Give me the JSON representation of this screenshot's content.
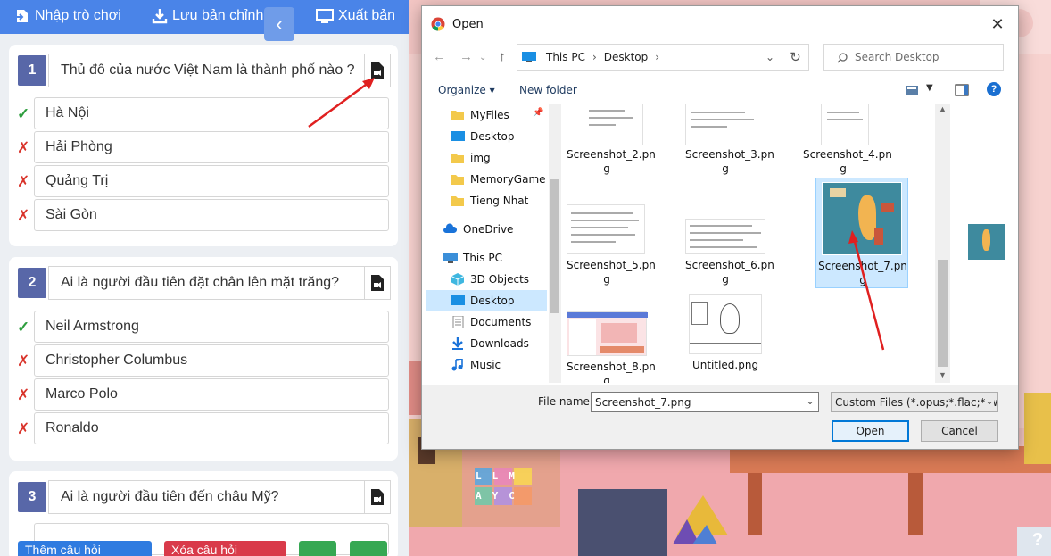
{
  "toolbar": {
    "import_label": "Nhập trò chơi",
    "save_label": "Lưu bản chỉnh sửa",
    "export_label": "Xuất bản"
  },
  "questions": [
    {
      "number": "1",
      "text": "Thủ đô của nước Việt Nam là thành phố nào ?",
      "answers": [
        {
          "text": "Hà Nội",
          "mark": "✓",
          "correct": true
        },
        {
          "text": "Hải Phòng",
          "mark": "✗",
          "correct": false
        },
        {
          "text": "Quảng Trị",
          "mark": "✗",
          "correct": false
        },
        {
          "text": "Sài Gòn",
          "mark": "✗",
          "correct": false
        }
      ]
    },
    {
      "number": "2",
      "text": "Ai là người đầu tiên đặt chân lên mặt trăng?",
      "answers": [
        {
          "text": "Neil Armstrong",
          "mark": "✓",
          "correct": true
        },
        {
          "text": "Christopher Columbus",
          "mark": "✗",
          "correct": false
        },
        {
          "text": "Marco Polo",
          "mark": "✗",
          "correct": false
        },
        {
          "text": "Ronaldo",
          "mark": "✗",
          "correct": false
        }
      ]
    },
    {
      "number": "3",
      "text": "Ai là người đầu tiên đến châu Mỹ?"
    }
  ],
  "bottom_buttons": {
    "add_label": "Thêm câu hỏi",
    "delete_label": "Xóa câu hỏi"
  },
  "scene": {
    "help_icon": "?",
    "blocks": [
      "L",
      "L",
      "M",
      "A",
      "Y",
      "C"
    ]
  },
  "dialog": {
    "title": "Open",
    "close_glyph": "✕",
    "breadcrumb": [
      "This PC",
      "Desktop"
    ],
    "search_placeholder": "Search Desktop",
    "organize_label": "Organize",
    "new_folder_label": "New folder",
    "nav_items": [
      {
        "label": "MyFiles",
        "icon": "folder-icon"
      },
      {
        "label": "Desktop",
        "icon": "desktop-icon"
      },
      {
        "label": "img",
        "icon": "folder-icon"
      },
      {
        "label": "MemoryGame",
        "icon": "folder-icon"
      },
      {
        "label": "Tieng Nhat",
        "icon": "folder-icon"
      },
      {
        "label": "OneDrive",
        "icon": "cloud-icon"
      },
      {
        "label": "This PC",
        "icon": "computer-icon"
      },
      {
        "label": "3D Objects",
        "icon": "cube-icon"
      },
      {
        "label": "Desktop",
        "icon": "desktop-icon",
        "selected": true
      },
      {
        "label": "Documents",
        "icon": "documents-icon"
      },
      {
        "label": "Downloads",
        "icon": "download-icon"
      },
      {
        "label": "Music",
        "icon": "music-icon"
      }
    ],
    "files": [
      {
        "line1": "Screenshot_2.pn",
        "line2": "g"
      },
      {
        "line1": "Screenshot_3.pn",
        "line2": "g"
      },
      {
        "line1": "Screenshot_4.pn",
        "line2": "g"
      },
      {
        "line1": "Screenshot_5.pn",
        "line2": "g"
      },
      {
        "line1": "Screenshot_6.pn",
        "line2": "g"
      },
      {
        "line1": "Screenshot_7.pn",
        "line2": "g",
        "selected": true
      },
      {
        "line1": "Screenshot_8.pn",
        "line2": "g"
      },
      {
        "line1": "Untitled.png",
        "line2": ""
      }
    ],
    "filename_label": "File name:",
    "filename_value": "Screenshot_7.png",
    "filetype_value": "Custom Files (*.opus;*.flac;*.we",
    "open_label": "Open",
    "cancel_label": "Cancel"
  },
  "colors": {
    "topbar": "#4a84e8",
    "question_number": "#5867a8",
    "correct": "#2e9e3e",
    "wrong": "#d9342b",
    "add_button": "#2f7be0",
    "delete_button": "#d93a4a",
    "green_button": "#36a853",
    "arrow": "#e02020",
    "selection": "#cce8ff"
  }
}
